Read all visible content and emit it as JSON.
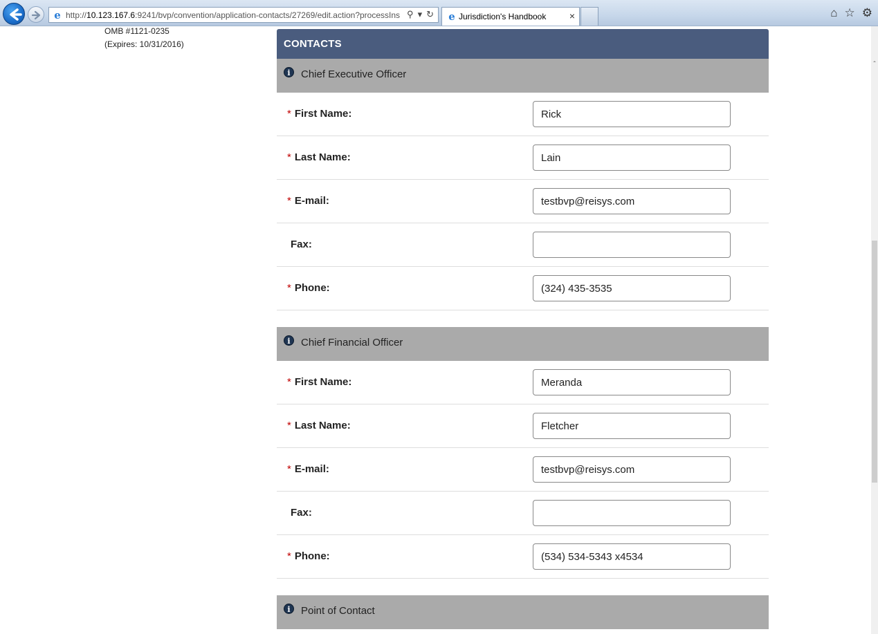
{
  "browser": {
    "url_prefix": "http://",
    "url_host": "10.123.167.6",
    "url_rest": ":9241/bvp/convention/application-contacts/27269/edit.action?processIns",
    "tab_title": "Jurisdiction's Handbook",
    "tab_close": "×",
    "icons": [
      "back-arrow-icon",
      "forward-arrow-icon",
      "ie-icon",
      "search-icon",
      "dropdown-icon",
      "refresh-icon",
      "home-icon",
      "star-icon",
      "gear-icon"
    ]
  },
  "meta": {
    "omb": "OMB #1121-0235",
    "expires": "(Expires: 10/31/2016)"
  },
  "panel": {
    "title": "CONTACTS"
  },
  "sections": [
    {
      "title": "Chief Executive Officer",
      "fields": [
        {
          "label": "First Name:",
          "required": "*",
          "value": "Rick"
        },
        {
          "label": "Last Name:",
          "required": "*",
          "value": "Lain"
        },
        {
          "label": "E-mail:",
          "required": "*",
          "value": "testbvp@reisys.com"
        },
        {
          "label": "Fax:",
          "required": "",
          "value": ""
        },
        {
          "label": "Phone:",
          "required": "*",
          "value": "(324) 435-3535"
        }
      ]
    },
    {
      "title": "Chief Financial Officer",
      "fields": [
        {
          "label": "First Name:",
          "required": "*",
          "value": "Meranda"
        },
        {
          "label": "Last Name:",
          "required": "*",
          "value": "Fletcher"
        },
        {
          "label": "E-mail:",
          "required": "*",
          "value": "testbvp@reisys.com"
        },
        {
          "label": "Fax:",
          "required": "",
          "value": ""
        },
        {
          "label": "Phone:",
          "required": "*",
          "value": "(534) 534-5343 x4534"
        }
      ]
    },
    {
      "title": "Point of Contact",
      "fields": []
    }
  ],
  "colors": {
    "header_bg": "#4a5c7e",
    "section_bg": "#aaaaaa",
    "required": "#c00000"
  }
}
